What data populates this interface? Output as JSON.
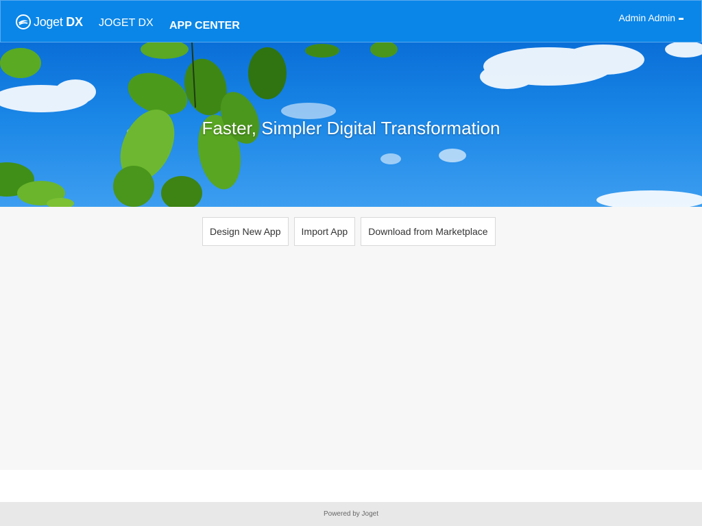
{
  "header": {
    "logo_text": "Joget",
    "logo_suffix": "DX",
    "app_name": "JOGET DX",
    "nav_title": "APP CENTER",
    "user_name": "Admin Admin"
  },
  "hero": {
    "title": "Faster, Simpler Digital Transformation"
  },
  "actions": {
    "design_new_app": "Design New App",
    "import_app": "Import App",
    "download_marketplace": "Download from Marketplace"
  },
  "footer": {
    "text": "Powered by Joget"
  },
  "colors": {
    "header_bg": "#0a86e8",
    "main_bg": "#f7f7f7",
    "footer_bg": "#e8e8e8"
  },
  "icons": {
    "logo": "joget-logo-icon",
    "user_menu": "caret-down-icon"
  }
}
